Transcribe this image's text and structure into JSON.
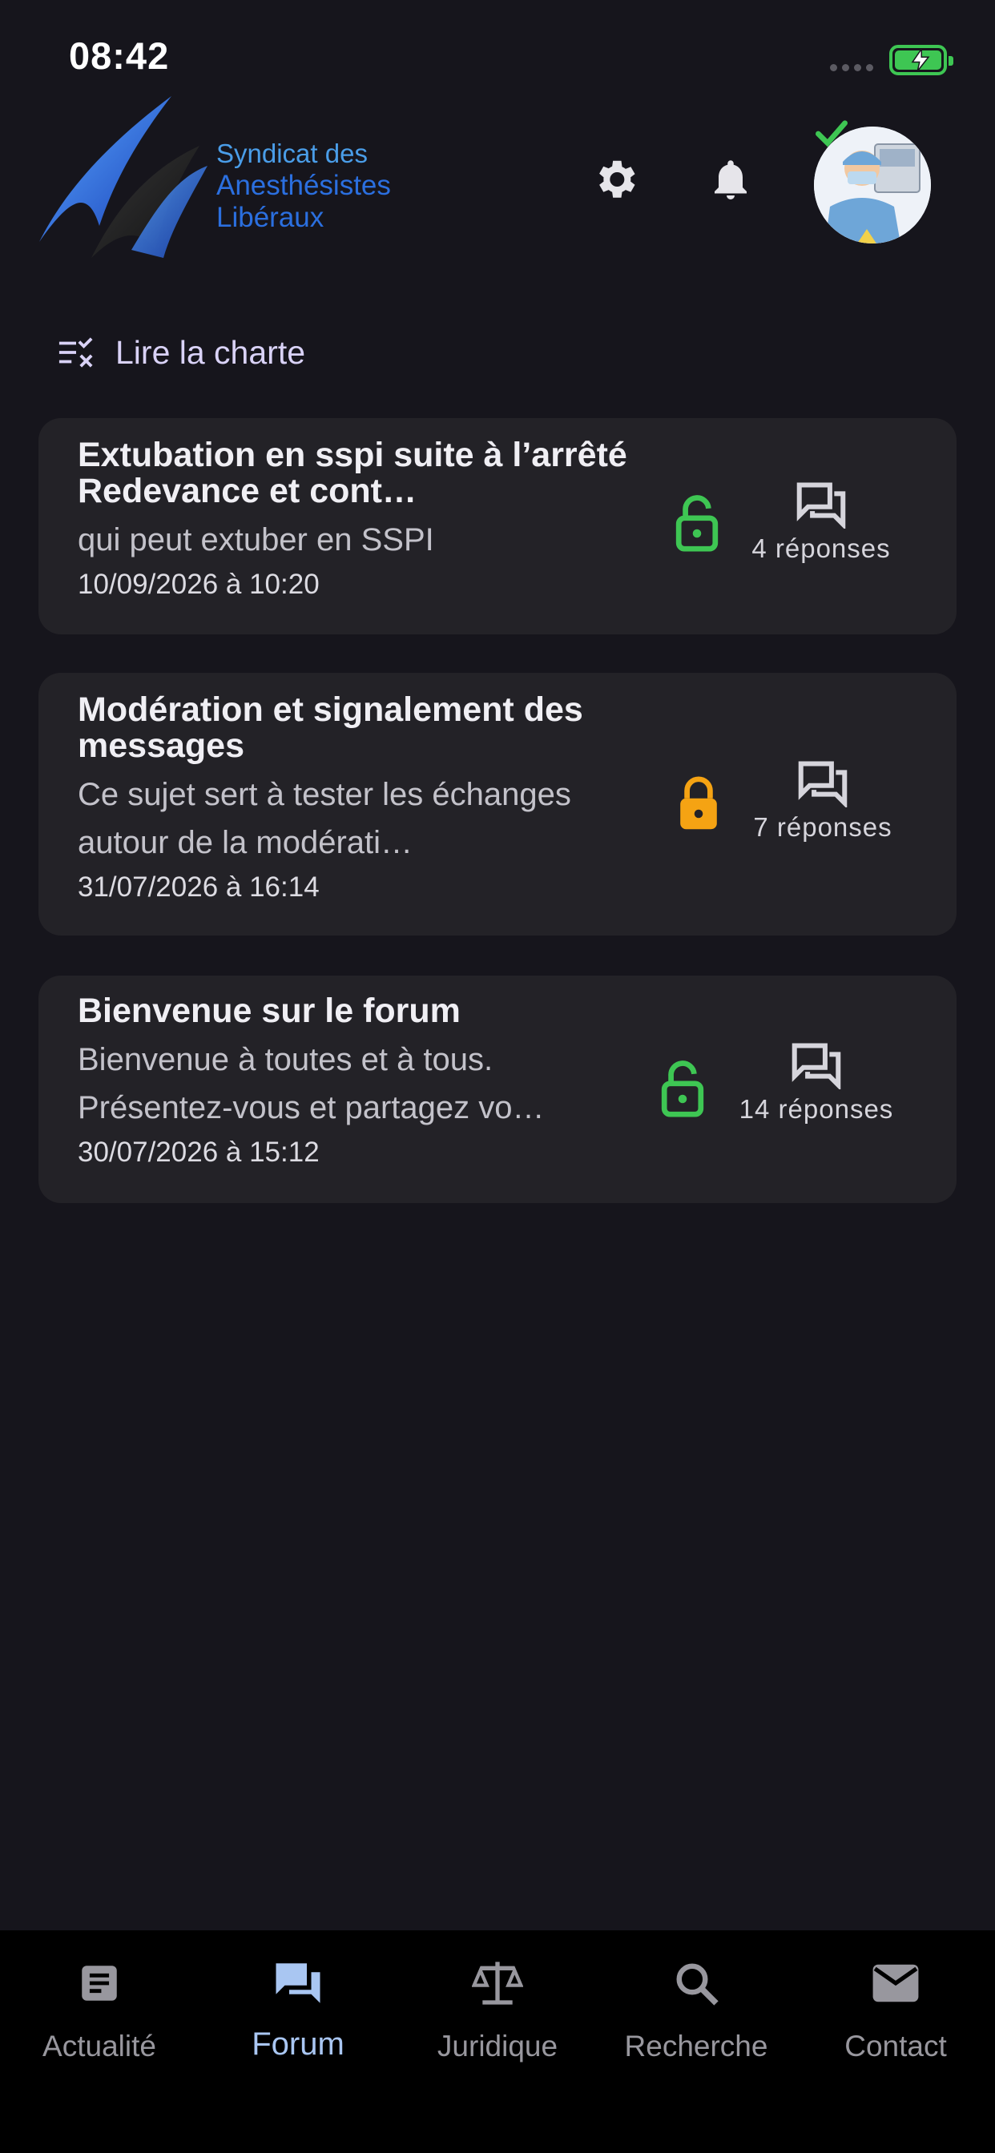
{
  "status": {
    "time": "08:42"
  },
  "header": {
    "logo_line1": "Syndicat des",
    "logo_line2": "Anesthésistes",
    "logo_line3": "Libéraux"
  },
  "charte": {
    "label": "Lire la charte"
  },
  "topics": [
    {
      "title": "Extubation en sspi suite à l’arrêté  Redevance et cont…",
      "excerpt": "qui peut extuber en SSPI",
      "date": "10/09/2026 à 10:20",
      "lock": "unlocked",
      "lock_color": "#3ec653",
      "replies": "4 réponses"
    },
    {
      "title": "Modération et signalement des messages",
      "excerpt": "Ce sujet sert à tester les échanges autour de la modérati…",
      "date": "31/07/2026 à 16:14",
      "lock": "locked",
      "lock_color": "#f5a313",
      "replies": "7 réponses"
    },
    {
      "title": "Bienvenue sur le forum",
      "excerpt": "Bienvenue à toutes et à tous. Présentez-vous et partagez vo…",
      "date": "30/07/2026 à 15:12",
      "lock": "unlocked",
      "lock_color": "#3ec653",
      "replies": "14 réponses"
    }
  ],
  "tabs": [
    {
      "label": "Actualité",
      "icon": "article-icon",
      "active": false
    },
    {
      "label": "Forum",
      "icon": "forum-icon",
      "active": true
    },
    {
      "label": "Juridique",
      "icon": "balance-icon",
      "active": false
    },
    {
      "label": "Recherche",
      "icon": "search-icon",
      "active": false
    },
    {
      "label": "Contact",
      "icon": "mail-icon",
      "active": false
    }
  ],
  "colors": {
    "accent": "#a9c6f2",
    "background": "#16151c",
    "card": "#232227",
    "unlocked": "#3ec653",
    "locked": "#f5a313"
  }
}
